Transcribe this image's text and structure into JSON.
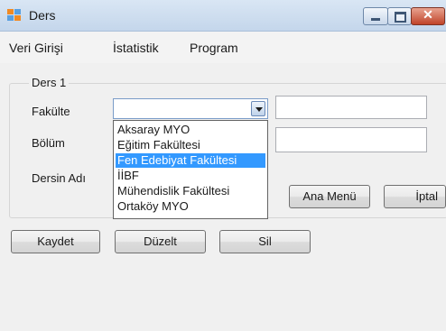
{
  "window": {
    "title": "Ders",
    "close_glyph": "✕"
  },
  "menu": [
    "Veri Girişi",
    "İstatistik",
    "Program"
  ],
  "group": {
    "title": "Ders 1",
    "labels": {
      "fakulte": "Fakülte",
      "bolum": "Bölüm",
      "dersin_adi": "Dersin Adı"
    }
  },
  "combo": {
    "value": "",
    "options": [
      "Aksaray MYO",
      "Eğitim Fakültesi",
      "Fen Edebiyat Fakültesi",
      "İİBF",
      "Mühendislik Fakültesi",
      "Ortaköy MYO"
    ],
    "highlighted_index": 2
  },
  "buttons": {
    "ana_menu": "Ana Menü",
    "iptal": "İptal",
    "kaydet": "Kaydet",
    "duzelt": "Düzelt",
    "sil": "Sil"
  }
}
